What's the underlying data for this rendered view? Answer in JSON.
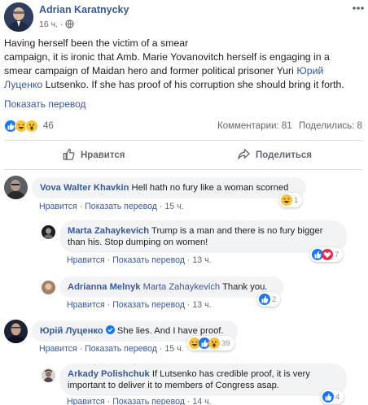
{
  "post": {
    "author": "Adrian Karatnycky",
    "time": "16 ч.",
    "text_lines": [
      "Having herself been the victim of a smear",
      "campaign, it is ironic that Amb. Marie Yovanovitch herself is engaging in a",
      "smear campaign of Maidan hero and former political prisoner Yuri",
      "Lutsenko. If she has proof of his corruption she should bring it forth."
    ],
    "mention_part1": "Юрий",
    "mention_part2": "Луценко",
    "see_translation": "Показать перевод",
    "reaction_count": "46",
    "comments_label": "Комментарии: 81",
    "shares_label": "Поделились: 8",
    "like_button": "Нравится",
    "share_button": "Поделиться"
  },
  "labels": {
    "like": "Нравится",
    "translate": "Показать перевод",
    "sep": "·"
  },
  "comments": [
    {
      "name": "Vova Walter Khavkin",
      "text": "Hell hath no fury like a woman scorned",
      "time": "15 ч.",
      "reactions": "1"
    },
    {
      "name": "Marta Zahaykevich",
      "text_line1": "Trump is a man and there is no fury bigger",
      "text_line2": "than his. Stop dumping on women!",
      "time": "13 ч.",
      "reactions": "7"
    },
    {
      "name": "Adrianna Melnyk",
      "mention": "Marta Zahaykevich",
      "text": "Thank you.",
      "time": "13 ч.",
      "reactions": "2"
    },
    {
      "name": "Юрій Луценко",
      "text": "She lies. And I have proof.",
      "time": "15 ч.",
      "reactions": "39"
    },
    {
      "name": "Arkady Polishchuk",
      "text_line1": "If Lutsenko has credible proof, it is very",
      "text_line2": "important to deliver it to members of Congress asap.",
      "time": "14 ч.",
      "reactions": "4"
    }
  ],
  "colors": {
    "link": "#385898",
    "like_blue": "#1877f2",
    "love_red": "#f0284a",
    "haha_yellow": "#f7c33c",
    "bubble": "#f2f3f5"
  }
}
